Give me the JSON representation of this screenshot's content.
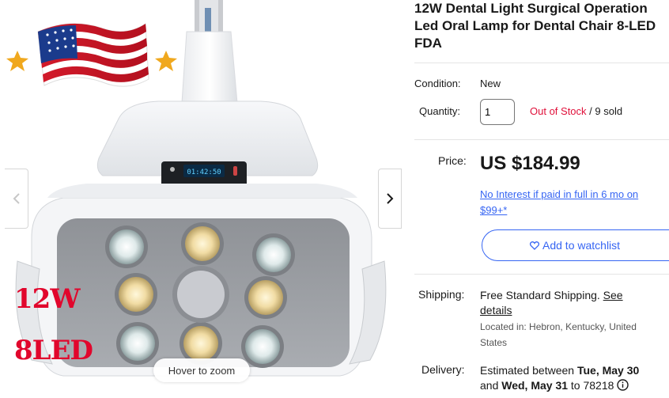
{
  "gallery": {
    "badge_12w": "12W",
    "badge_8led": "8LED",
    "hover_zoom": "Hover to zoom",
    "display_readout": "01:42:50"
  },
  "product": {
    "title_lines": [
      "12W Dental Light Surgical Operation",
      "Led Oral Lamp for Dental Chair 8-LED",
      "FDA"
    ],
    "condition_label": "Condition:",
    "condition_value": "New",
    "quantity_label": "Quantity:",
    "quantity_value": "1",
    "stock_status": "Out of Stock",
    "sold_text": " / 9 sold",
    "price_label": "Price:",
    "price_value": "US $184.99",
    "promo_line1": "No Interest if paid in full in 6 mo on",
    "promo_line2": "$99+*",
    "watchlist_label": "Add to watchlist",
    "shipping_label": "Shipping:",
    "shipping_free": "Free",
    "shipping_standard": " Standard Shipping. ",
    "shipping_see": "See",
    "shipping_details": "details",
    "location_line1": "Located in: Hebron, Kentucky, United",
    "location_line2": "States",
    "delivery_label": "Delivery:",
    "delivery_prefix": "Estimated between ",
    "delivery_start": "Tue, May 30",
    "delivery_and": "and ",
    "delivery_end": "Wed, May 31",
    "delivery_to": " to 78218"
  },
  "colors": {
    "link_blue": "#3665f3",
    "out_of_stock_red": "#e0103a",
    "badge_red": "#e1062c"
  },
  "icons": {
    "prev": "chevron-left-icon",
    "next": "chevron-right-icon",
    "watch": "heart-icon",
    "info": "info-circle-icon"
  }
}
